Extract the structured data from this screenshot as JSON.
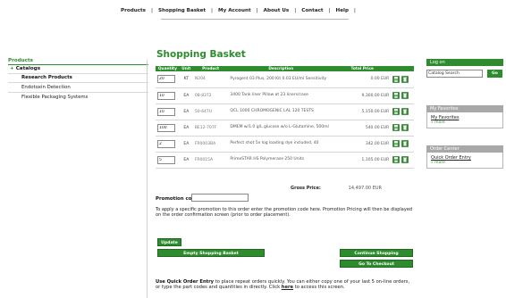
{
  "topnav": {
    "products": "Products",
    "basket": "Shopping Basket",
    "account": "My Account",
    "about": "About Us",
    "contact": "Contact",
    "help": "Help",
    "sep": "|"
  },
  "sidebar": {
    "title": "Products",
    "catalogs": "Catalogs",
    "plus": "+",
    "items": [
      {
        "label": "Research Products",
        "active": true
      },
      {
        "label": "Endotoxin Detection",
        "active": false
      },
      {
        "label": "Flexible Packaging Systems",
        "active": false
      }
    ]
  },
  "basket": {
    "title": "Shopping Basket",
    "headers": [
      "Quantity",
      "Unit",
      "Product",
      "Description",
      "Total Price"
    ],
    "rows": [
      {
        "qty": "20",
        "unit": "KT",
        "product": "N204",
        "description": "Pyrogent 03 Plus, 200 Kit 0.03 EU/ml Sensitivity",
        "price": "0.00 EUR"
      },
      {
        "qty": "10",
        "unit": "EA",
        "product": "08-8372",
        "description": "3400 Tank liner Pillow at 23 liners/case",
        "price": "9,300.00 EUR"
      },
      {
        "qty": "10",
        "unit": "EA",
        "product": "50-647U",
        "description": "QCL 1000 CHROMOGENIC LAL 120 TESTS",
        "price": "5,150.00 EUR"
      },
      {
        "qty": "100",
        "unit": "EA",
        "product": "BE12-707F",
        "description": "DMEM w/1.0 g/L glucose w/o L-Glutamine, 500ml",
        "price": "540.00 EUR"
      },
      {
        "qty": "2",
        "unit": "EA",
        "product": "FR0003BA",
        "description": "Perfect shot 5x log loading dye included, 40",
        "price": "342.00 EUR"
      },
      {
        "qty": "5",
        "unit": "EA",
        "product": "FR0015A",
        "description": "PrimeSTAR HS Polymerase 250 Units",
        "price": "1,105.00 EUR"
      }
    ],
    "gross_label": "Gross Price:",
    "gross_value": "14,497.00 EUR",
    "icon_colors": {
      "save": "#2e8b2e",
      "delete": "#2e8b2e"
    }
  },
  "promo": {
    "label": "Promotion code:",
    "value": "",
    "text": "To apply a specific promotion to this order enter the promotion code here. Promotion Pricing will then be displayed on the order confirmation screen (prior to order placement)."
  },
  "buttons": {
    "update": "Update",
    "empty": "Empty Shopping Basket",
    "continue": "Continue Shopping",
    "checkout": "Go To Checkout"
  },
  "quick_order_text": {
    "bold": "Use Quick Order Entry",
    "part1": " to place repeat orders quickly. You can either copy one of your last 5 on-line orders, or type the part codes and quantities in directly. Click ",
    "here": "here",
    "part2": " to access this screen."
  },
  "right": {
    "login": "Log on",
    "search_value": "Catalog Search",
    "go": "Go",
    "favorites_title": "My Favorites",
    "favorites_link": "My Favorites",
    "more": "» more",
    "order_center_title": "Order Center",
    "quick_order_link": "Quick Order Entry"
  },
  "colors": {
    "accent": "#2e8b2e",
    "grey_header": "#a8a8a8"
  }
}
